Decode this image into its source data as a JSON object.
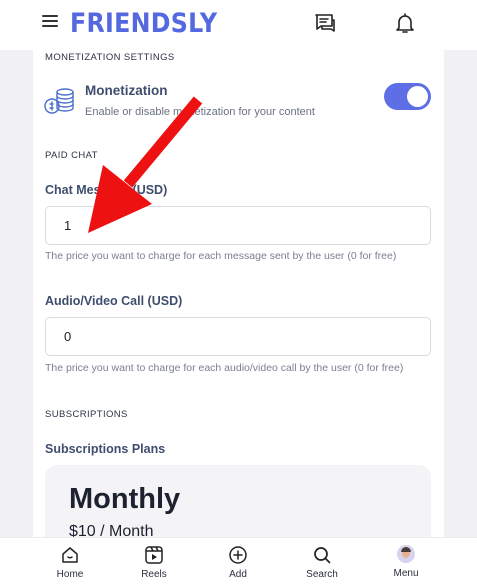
{
  "header": {
    "logo": "FRIENDSLY",
    "icons": [
      "menu-icon",
      "chat-icon",
      "bell-icon"
    ]
  },
  "monetization": {
    "section_label": "MONETIZATION SETTINGS",
    "title": "Monetization",
    "subtitle": "Enable or disable monetization for your content",
    "enabled": true,
    "icon": "coins-icon"
  },
  "paid_chat": {
    "section_label": "PAID CHAT",
    "chat_label": "Chat Message (USD)",
    "chat_value": "1",
    "chat_help": "The price you want to charge for each message sent by the user (0 for free)",
    "call_label": "Audio/Video Call (USD)",
    "call_value": "0",
    "call_help": "The price you want to charge for each audio/video call by the user (0 for free)"
  },
  "subscriptions": {
    "section_label": "SUBSCRIPTIONS",
    "title": "Subscriptions Plans",
    "plans": [
      {
        "name": "Monthly",
        "price": "$10 / Month"
      }
    ]
  },
  "annotation": {
    "color": "#ee1111",
    "shape": "arrow"
  },
  "colors": {
    "brand": "#5468e0",
    "toggle": "#5e6ee4"
  },
  "bottom_nav": {
    "items": [
      {
        "label": "Home",
        "icon": "home-icon"
      },
      {
        "label": "Reels",
        "icon": "reels-icon"
      },
      {
        "label": "Add",
        "icon": "add-icon"
      },
      {
        "label": "Search",
        "icon": "search-icon"
      },
      {
        "label": "Menu",
        "icon": "avatar"
      }
    ]
  }
}
